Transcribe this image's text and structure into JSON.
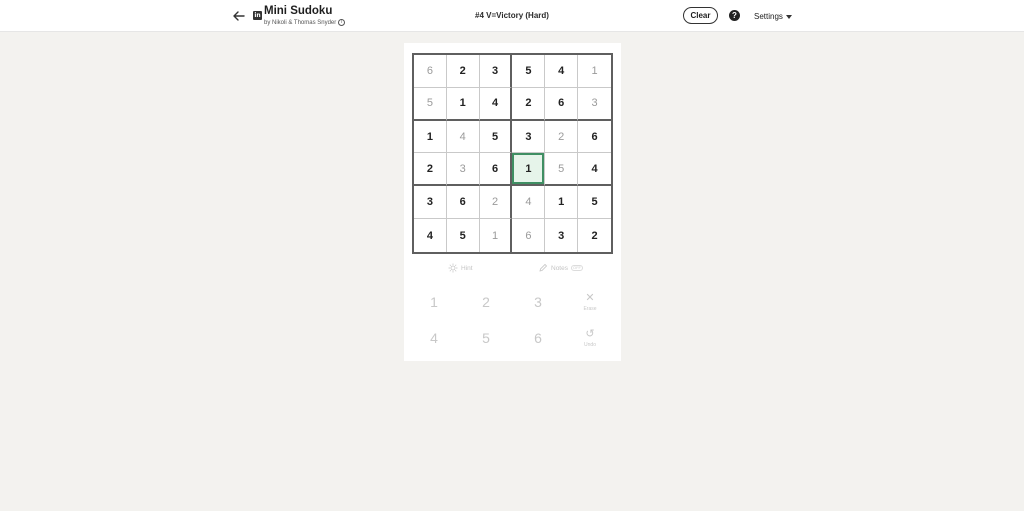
{
  "header": {
    "title": "Mini Sudoku",
    "byline": "by Nikoli & Thomas Snyder",
    "puzzle_title": "#4 V=Victory (Hard)",
    "clear_label": "Clear",
    "help_label": "?",
    "settings_label": "Settings"
  },
  "board": {
    "rows": [
      [
        {
          "v": "6",
          "given": true
        },
        {
          "v": "2",
          "given": false
        },
        {
          "v": "3",
          "given": false
        },
        {
          "v": "5",
          "given": false
        },
        {
          "v": "4",
          "given": false
        },
        {
          "v": "1",
          "given": true
        }
      ],
      [
        {
          "v": "5",
          "given": true
        },
        {
          "v": "1",
          "given": false
        },
        {
          "v": "4",
          "given": false
        },
        {
          "v": "2",
          "given": false
        },
        {
          "v": "6",
          "given": false
        },
        {
          "v": "3",
          "given": true
        }
      ],
      [
        {
          "v": "1",
          "given": false
        },
        {
          "v": "4",
          "given": true
        },
        {
          "v": "5",
          "given": false
        },
        {
          "v": "3",
          "given": false
        },
        {
          "v": "2",
          "given": true
        },
        {
          "v": "6",
          "given": false
        }
      ],
      [
        {
          "v": "2",
          "given": false
        },
        {
          "v": "3",
          "given": true
        },
        {
          "v": "6",
          "given": false
        },
        {
          "v": "1",
          "given": false,
          "selected": true
        },
        {
          "v": "5",
          "given": true
        },
        {
          "v": "4",
          "given": false
        }
      ],
      [
        {
          "v": "3",
          "given": false
        },
        {
          "v": "6",
          "given": false
        },
        {
          "v": "2",
          "given": true
        },
        {
          "v": "4",
          "given": true
        },
        {
          "v": "1",
          "given": false
        },
        {
          "v": "5",
          "given": false
        }
      ],
      [
        {
          "v": "4",
          "given": false
        },
        {
          "v": "5",
          "given": false
        },
        {
          "v": "1",
          "given": true
        },
        {
          "v": "6",
          "given": true
        },
        {
          "v": "3",
          "given": false
        },
        {
          "v": "2",
          "given": false
        }
      ]
    ]
  },
  "tools": {
    "hint_label": "Hint",
    "notes_label": "Notes",
    "notes_toggle": "OFF"
  },
  "keypad": {
    "keys": [
      "1",
      "2",
      "3",
      "4",
      "5",
      "6"
    ],
    "erase_label": "Erase",
    "undo_label": "Undo"
  },
  "colors": {
    "selected_border": "#3f8f63",
    "selected_fill": "#e6f4ea",
    "background": "#f3f2ef"
  }
}
